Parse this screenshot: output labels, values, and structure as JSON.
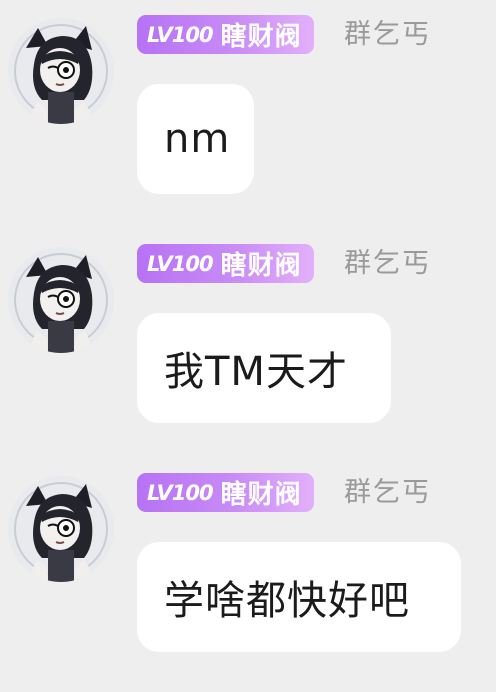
{
  "messages": [
    {
      "level": "LV100",
      "title": "瞎财阀",
      "group": "群乞丐",
      "text": "nm"
    },
    {
      "level": "LV100",
      "title": "瞎财阀",
      "group": "群乞丐",
      "text": "我TM天才"
    },
    {
      "level": "LV100",
      "title": "瞎财阀",
      "group": "群乞丐",
      "text": "学啥都快好吧"
    }
  ],
  "colors": {
    "background": "#eeeeee",
    "bubble": "#ffffff",
    "badge_start": "#b672f4",
    "badge_end": "#e2b0fa",
    "group_text": "#9a9a9a",
    "message_text": "#1b1b1b"
  },
  "icons": {
    "avatar": "anime-girl-avatar-icon"
  }
}
